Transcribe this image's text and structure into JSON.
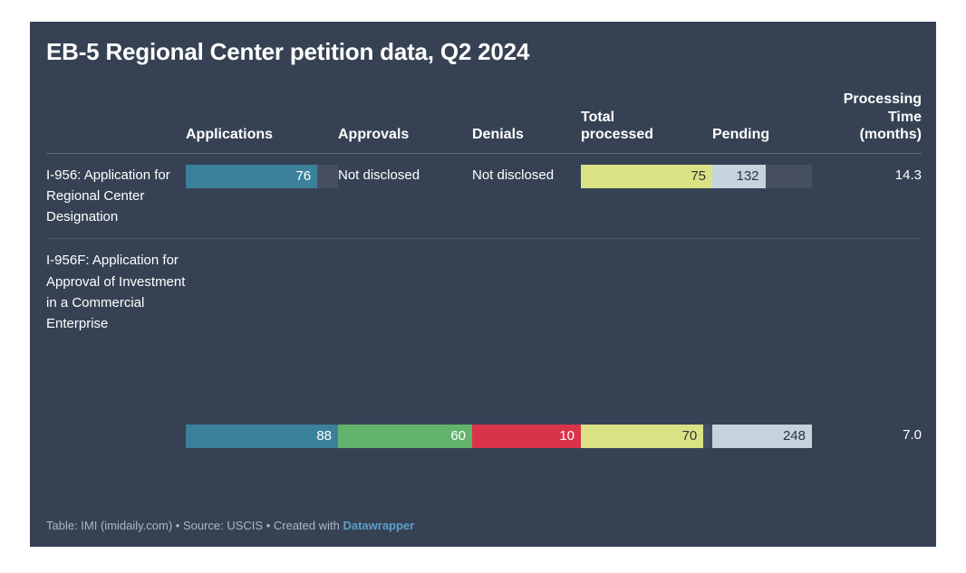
{
  "card": {
    "background": "#364254",
    "title": "EB-5 Regional Center petition data, Q2 2024"
  },
  "columns": [
    {
      "key": "form",
      "label": ""
    },
    {
      "key": "applications",
      "label": "Applications"
    },
    {
      "key": "approvals",
      "label": "Approvals"
    },
    {
      "key": "denials",
      "label": "Denials"
    },
    {
      "key": "total",
      "label": "Total\nprocessed",
      "line1": "Total",
      "line2": "processed"
    },
    {
      "key": "pending",
      "label": "Pending"
    },
    {
      "key": "time",
      "label": "Processing Time (months)",
      "line1": "Processing",
      "line2": "Time",
      "line3": "(months)"
    }
  ],
  "rows": [
    {
      "form": "I-956: Application for Regional Center Designation",
      "applications": {
        "value": "76",
        "numeric": 76,
        "bar": true,
        "pct": 86.4,
        "color": "#3b819b",
        "text_color": "light",
        "track": true
      },
      "approvals": {
        "value": "Not disclosed",
        "bar": false
      },
      "denials": {
        "value": "Not disclosed",
        "bar": false
      },
      "total": {
        "value": "75",
        "numeric": 75,
        "bar": true,
        "pct": 100,
        "color": "#d9e383",
        "text_color": "dark",
        "track": false
      },
      "pending": {
        "value": "132",
        "numeric": 132,
        "bar": true,
        "pct": 53.2,
        "color": "#c5d3dd",
        "text_color": "dark",
        "track": true
      },
      "time": {
        "value": "14.3",
        "numeric": 14.3
      }
    },
    {
      "form": "I-956F: Application for Approval of Investment in a Commercial Enterprise",
      "applications": {
        "value": "88",
        "numeric": 88,
        "bar": true,
        "pct": 100,
        "color": "#3b819b",
        "text_color": "light",
        "track": false
      },
      "approvals": {
        "value": "60",
        "numeric": 60,
        "bar": true,
        "pct": 100,
        "color": "#62b46c",
        "text_color": "light",
        "track": false
      },
      "denials": {
        "value": "10",
        "numeric": 10,
        "bar": true,
        "pct": 100,
        "color": "#d9334a",
        "text_color": "light",
        "track": false
      },
      "total": {
        "value": "70",
        "numeric": 70,
        "bar": true,
        "pct": 93.3,
        "color": "#d9e383",
        "text_color": "dark",
        "track": true
      },
      "pending": {
        "value": "248",
        "numeric": 248,
        "bar": true,
        "pct": 100,
        "color": "#c5d3dd",
        "text_color": "dark",
        "track": false
      },
      "time": {
        "value": "7.0",
        "numeric": 7.0
      }
    }
  ],
  "footer": {
    "prefix": "Table: IMI (imidaily.com) • Source: USCIS • Created with ",
    "brand": "Datawrapper"
  },
  "chart_data": {
    "type": "table",
    "title": "EB-5 Regional Center petition data, Q2 2024",
    "columns": [
      "",
      "Applications",
      "Approvals",
      "Denials",
      "Total processed",
      "Pending",
      "Processing Time (months)"
    ],
    "rows": [
      [
        "I-956: Application for Regional Center Designation",
        76,
        "Not disclosed",
        "Not disclosed",
        75,
        132,
        14.3
      ],
      [
        "I-956F: Application for Approval of Investment in a Commercial Enterprise",
        88,
        60,
        10,
        70,
        248,
        7.0
      ]
    ],
    "bar_colors": {
      "applications": "#3b819b",
      "approvals": "#62b46c",
      "denials": "#d9334a",
      "total_processed": "#d9e383",
      "pending": "#c5d3dd"
    },
    "notes": "Numeric cells rendered as in-cell horizontal bars scaled to each column's maximum."
  }
}
